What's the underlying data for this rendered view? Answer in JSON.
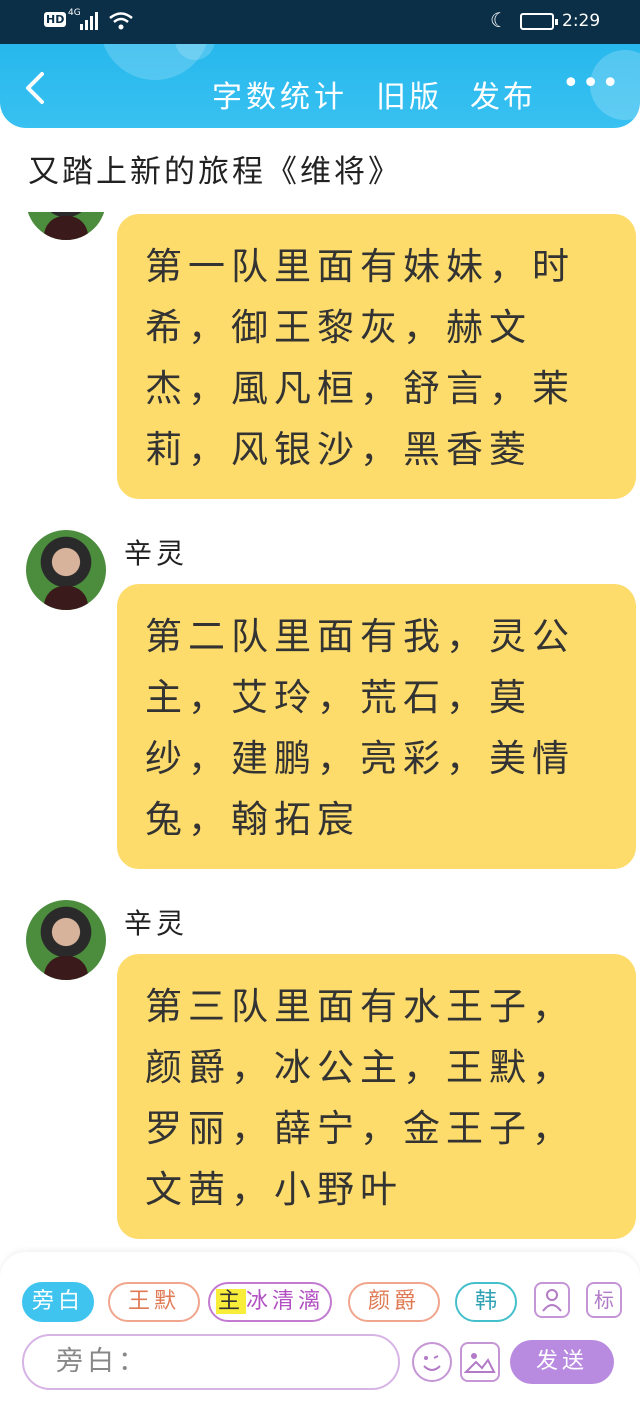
{
  "status_bar": {
    "network_badge": "HD",
    "network_type": "4G",
    "time": "2:29"
  },
  "header": {
    "title": "字数统计",
    "old_version": "旧版",
    "publish": "发布",
    "more": "•••"
  },
  "story_title": "又踏上新的旅程《维将》",
  "messages": [
    {
      "sender": "",
      "text": "第一队里面有妹妹，时希，御王黎灰，赫文杰，風凡桓，舒言，茉莉，风银沙，黑香菱"
    },
    {
      "sender": "辛灵",
      "text": "第二队里面有我，灵公主，艾玲，荒石，莫纱，建鹏，亮彩，美情兔，翰拓宸"
    },
    {
      "sender": "辛灵",
      "text": "第三队里面有水王子，颜爵，冰公主，王默，罗丽，薛宁，金王子，文茜，小野叶"
    }
  ],
  "composer": {
    "roles": [
      {
        "label": "旁白",
        "active": true
      },
      {
        "label": "王默"
      },
      {
        "label_highlight": "主",
        "label": "冰清漓"
      },
      {
        "label": "颜爵"
      },
      {
        "label": "韩冰"
      }
    ],
    "tool_mark": "标",
    "placeholder": "旁白：",
    "send_label": "发送"
  }
}
